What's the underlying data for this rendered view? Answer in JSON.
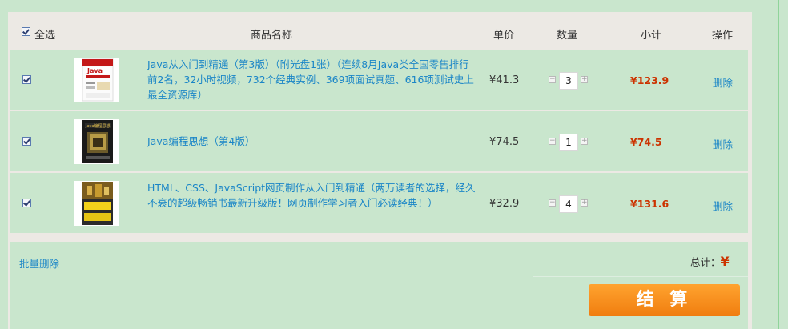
{
  "header": {
    "select_all": "全选",
    "product_name": "商品名称",
    "unit_price": "单价",
    "quantity": "数量",
    "subtotal": "小计",
    "actions": "操作"
  },
  "items": [
    {
      "name": "Java从入门到精通（第3版）（附光盘1张）（连续8月Java类全国零售排行前2名，32小时视频，732个经典实例、369项面试真题、616项测试史上最全资源库）",
      "price": "¥41.3",
      "qty": "3",
      "subtotal": "¥123.9",
      "delete": "删除",
      "checked": true
    },
    {
      "name": "Java编程思想（第4版）",
      "price": "¥74.5",
      "qty": "1",
      "subtotal": "¥74.5",
      "delete": "删除",
      "checked": true
    },
    {
      "name": "HTML、CSS、JavaScript网页制作从入门到精通（两万读者的选择，经久不衰的超级畅销书最新升级版！网页制作学习者入门必读经典！）",
      "price": "¥32.9",
      "qty": "4",
      "subtotal": "¥131.6",
      "delete": "删除",
      "checked": true
    }
  ],
  "footer": {
    "batch_delete": "批量删除",
    "total_label": "总计：",
    "total_currency": "¥",
    "checkout": "结 算"
  },
  "colors": {
    "accent_link": "#1b86c7",
    "price_red": "#cc3300",
    "checkout_orange": "#f7901e",
    "row_bg": "#c9e6cd"
  }
}
